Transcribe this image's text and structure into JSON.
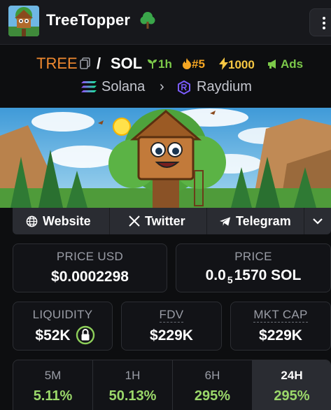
{
  "header": {
    "app_title": "TreeTopper"
  },
  "pair": {
    "base": "TREE",
    "slash": "/",
    "quote": "SOL",
    "age": "1h",
    "rank": "#5",
    "boosts": "1000",
    "ads": "Ads",
    "chain": "Solana",
    "dex": "Raydium",
    "accent_base": "#f0892f",
    "accent_green": "#7cc94a"
  },
  "social": {
    "website": "Website",
    "twitter": "Twitter",
    "telegram": "Telegram"
  },
  "stats": {
    "price_usd_label": "PRICE USD",
    "price_usd": "$0.0002298",
    "price_label": "PRICE",
    "price_prefix": "0.0",
    "price_sub": "5",
    "price_rest": "1570 SOL",
    "liquidity_label": "LIQUIDITY",
    "liquidity": "$52K",
    "fdv_label": "FDV",
    "fdv": "$229K",
    "mcap_label": "MKT CAP",
    "mcap": "$229K"
  },
  "timeframes": [
    {
      "label": "5M",
      "value": "5.11%"
    },
    {
      "label": "1H",
      "value": "50.13%"
    },
    {
      "label": "6H",
      "value": "295%"
    },
    {
      "label": "24H",
      "value": "295%"
    }
  ]
}
